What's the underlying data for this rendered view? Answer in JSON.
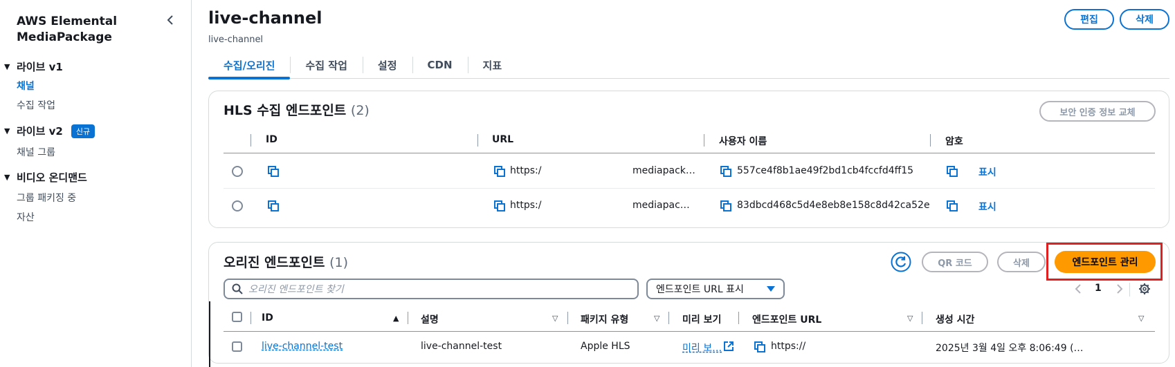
{
  "sidebar": {
    "title": "AWS Elemental MediaPackage",
    "sections": [
      {
        "label": "라이브 v1",
        "items": [
          {
            "label": "채널",
            "active": true
          },
          {
            "label": "수집 작업"
          }
        ]
      },
      {
        "label": "라이브 v2",
        "badge": "신규",
        "items": [
          {
            "label": "채널 그룹"
          }
        ]
      },
      {
        "label": "비디오 온디맨드",
        "items": [
          {
            "label": "그룹 패키징 중"
          },
          {
            "label": "자산"
          }
        ]
      }
    ]
  },
  "header": {
    "title": "live-channel",
    "subtitle": "live-channel",
    "edit_label": "편집",
    "delete_label": "삭제"
  },
  "tabs": [
    {
      "label": "수집/오리진",
      "active": true
    },
    {
      "label": "수집 작업"
    },
    {
      "label": "설정"
    },
    {
      "label": "CDN"
    },
    {
      "label": "지표"
    }
  ],
  "hls": {
    "title": "HLS 수집 엔드포인트",
    "count": "(2)",
    "rotate_label": "보안 인증 정보 교체",
    "columns": [
      "ID",
      "URL",
      "사용자 이름",
      "암호"
    ],
    "rows": [
      {
        "url_prefix": "https:/",
        "url_host": "mediapack…",
        "username": "557ce4f8b1ae49f2bd1cb4fccfd4ff15",
        "password_label": "표시"
      },
      {
        "url_prefix": "https:/",
        "url_host": "mediapac…",
        "username": "83dbcd468c5d4e8eb8e158c8d42ca52e",
        "password_label": "표시"
      }
    ]
  },
  "origin": {
    "title": "오리진 엔드포인트",
    "count": "(1)",
    "qr_label": "QR 코드",
    "delete_label": "삭제",
    "manage_label": "엔드포인트 관리",
    "search_placeholder": "오리진 엔드포인트 찾기",
    "select_value": "엔드포인트 URL 표시",
    "page_number": "1",
    "columns": [
      "ID",
      "설명",
      "패키지 유형",
      "미리 보기",
      "엔드포인트 URL",
      "생성 시간"
    ],
    "rows": [
      {
        "id": "live-channel-test",
        "description": "live-channel-test",
        "package_type": "Apple HLS",
        "preview": "미리 보…",
        "endpoint_url": "https://",
        "created": "2025년 3월 4일 오후 8:06:49 (…"
      }
    ]
  },
  "colors": {
    "accent": "#0972d3",
    "orange": "#ff9900",
    "highlight": "#e02020"
  }
}
